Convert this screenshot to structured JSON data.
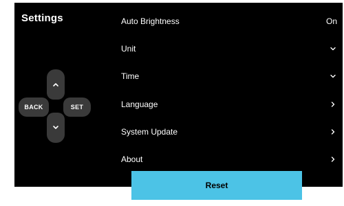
{
  "screen": {
    "title": "Settings",
    "background": "#000000"
  },
  "dpad": {
    "up_icon": "chevron-up-icon",
    "down_icon": "chevron-down-icon",
    "back_label": "BACK",
    "set_label": "SET",
    "button_color": "#3a3a3a"
  },
  "menu": {
    "items": [
      {
        "label": "Auto Brightness",
        "value": "On",
        "icon": ""
      },
      {
        "label": "Unit",
        "value": "",
        "icon": "chevron-down-icon"
      },
      {
        "label": "Time",
        "value": "",
        "icon": "chevron-down-icon"
      },
      {
        "label": "Language",
        "value": "",
        "icon": "chevron-right-icon"
      },
      {
        "label": "System Update",
        "value": "",
        "icon": "chevron-right-icon"
      },
      {
        "label": "About",
        "value": "",
        "icon": "chevron-right-icon"
      }
    ]
  },
  "reset": {
    "label": "Reset",
    "color": "#4cc3e6"
  }
}
